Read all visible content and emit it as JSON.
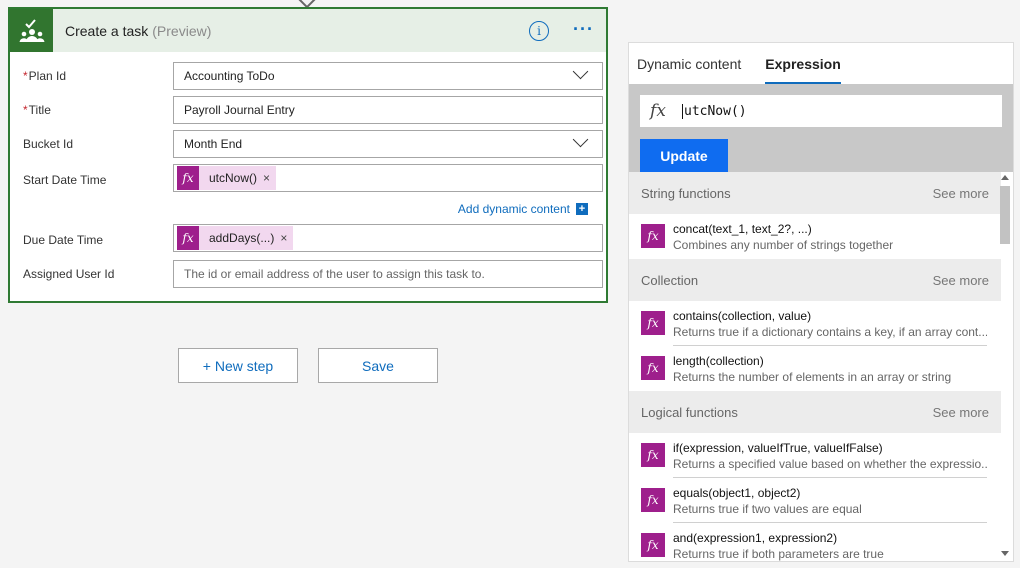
{
  "card": {
    "title": "Create a task",
    "preview": "(Preview)",
    "info_icon": "info-icon",
    "more_icon": "ellipsis-icon",
    "fields": {
      "plan_id": {
        "label": "Plan Id",
        "required": "*",
        "value": "Accounting ToDo"
      },
      "title": {
        "label": "Title",
        "required": "*",
        "value": "Payroll Journal Entry"
      },
      "bucket_id": {
        "label": "Bucket Id",
        "value": "Month End"
      },
      "start_date_time": {
        "label": "Start Date Time",
        "token": "utcNow()",
        "token_fx": "fx",
        "remove": "×"
      },
      "add_dynamic": "Add dynamic content",
      "add_dynamic_plus": "+",
      "due_date_time": {
        "label": "Due Date Time",
        "token": "addDays(...)",
        "token_fx": "fx",
        "remove": "×"
      },
      "assigned_user_id": {
        "label": "Assigned User Id",
        "placeholder": "The id or email address of the user to assign this task to."
      }
    }
  },
  "actions": {
    "new_step": "+ New step",
    "save": "Save"
  },
  "panel": {
    "tabs": [
      "Dynamic content",
      "Expression"
    ],
    "active_tab": "Expression",
    "expression": {
      "fx": "fx",
      "value": "utcNow()"
    },
    "update": "Update",
    "sections": [
      {
        "title": "String functions",
        "see_more": "See more",
        "items": [
          {
            "name": "concat(text_1, text_2?, ...)",
            "desc": "Combines any number of strings together"
          }
        ]
      },
      {
        "title": "Collection",
        "see_more": "See more",
        "items": [
          {
            "name": "contains(collection, value)",
            "desc": "Returns true if a dictionary contains a key, if an array cont..."
          },
          {
            "name": "length(collection)",
            "desc": "Returns the number of elements in an array or string"
          }
        ]
      },
      {
        "title": "Logical functions",
        "see_more": "See more",
        "items": [
          {
            "name": "if(expression, valueIfTrue, valueIfFalse)",
            "desc": "Returns a specified value based on whether the expressio..."
          },
          {
            "name": "equals(object1, object2)",
            "desc": "Returns true if two values are equal"
          },
          {
            "name": "and(expression1, expression2)",
            "desc": "Returns true if both parameters are true"
          }
        ]
      }
    ]
  },
  "colors": {
    "accent": "#0f6cbd",
    "header_bg": "#e6efe6",
    "card_border": "#2f7a33",
    "fx_token": "#9e1f8c"
  }
}
